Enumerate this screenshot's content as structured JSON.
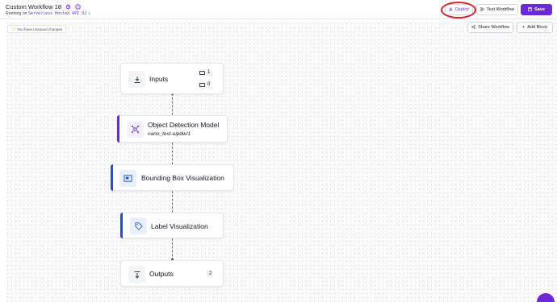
{
  "header": {
    "title": "Custom Workflow 18",
    "subtitle_prefix": "Running on",
    "server": "Serverless Hosted API V2",
    "deploy_label": "Deploy",
    "test_label": "Test Workflow",
    "save_label": "Save"
  },
  "canvas": {
    "unsaved_text": "You have unsaved changes",
    "share_label": "Share Workflow",
    "add_block_label": "Add Block"
  },
  "nodes": {
    "inputs": {
      "label": "Inputs",
      "image_count": "1",
      "param_count": "0"
    },
    "detection": {
      "label": "Object Detection Model",
      "model": "nano_test-uipdw/1"
    },
    "bbox": {
      "label": "Bounding Box Visualization"
    },
    "labelvis": {
      "label": "Label Visualization"
    },
    "outputs": {
      "label": "Outputs",
      "count": "2"
    }
  },
  "colors": {
    "brand": "#6d28d9",
    "highlight_ring": "#e11d2a",
    "detection_accent": "#6d28d9",
    "visualization_accent": "#1d4ed8",
    "check": "#16a34a",
    "warning": "#f59e0b"
  },
  "icons": {
    "settings": "gear-icon",
    "help": "question-icon",
    "deploy": "rocket-icon",
    "test": "play-icon",
    "save": "save-icon",
    "share": "share-icon",
    "add": "plus-icon",
    "inputs": "download-icon",
    "detection": "network-icon",
    "bbox": "image-icon",
    "labelvis": "tag-icon",
    "outputs": "upload-icon"
  }
}
